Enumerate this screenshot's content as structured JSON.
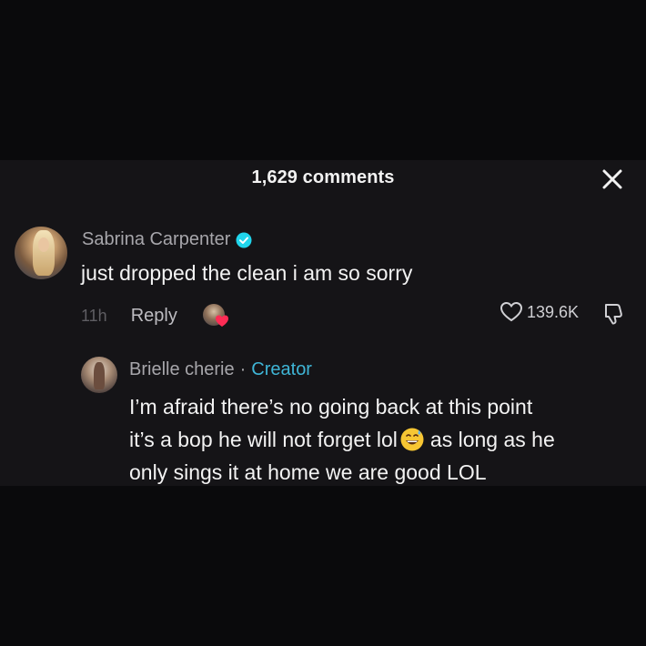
{
  "header": {
    "title": "1,629 comments",
    "close_icon": "close-icon"
  },
  "comment": {
    "username": "Sabrina Carpenter",
    "verified": true,
    "text": "just dropped the clean i am so sorry",
    "time": "11h",
    "reply_label": "Reply",
    "likes": "139.6K",
    "liked_by_creator": true
  },
  "reply": {
    "username": "Brielle cherie",
    "separator": "·",
    "badge": "Creator",
    "line1": "I’m afraid there’s no going back at this point",
    "line2a": "it’s a bop he will not forget lol",
    "emoji": "grinning-sweat-emoji",
    "line2b": "as long as he",
    "line3": "only sings it at home we are good LOL"
  },
  "colors": {
    "background": "#0a0a0c",
    "panel": "#151417",
    "creator_accent": "#3fb5d6",
    "verified": "#20d5ec",
    "like_heart": "#fe2c55"
  }
}
